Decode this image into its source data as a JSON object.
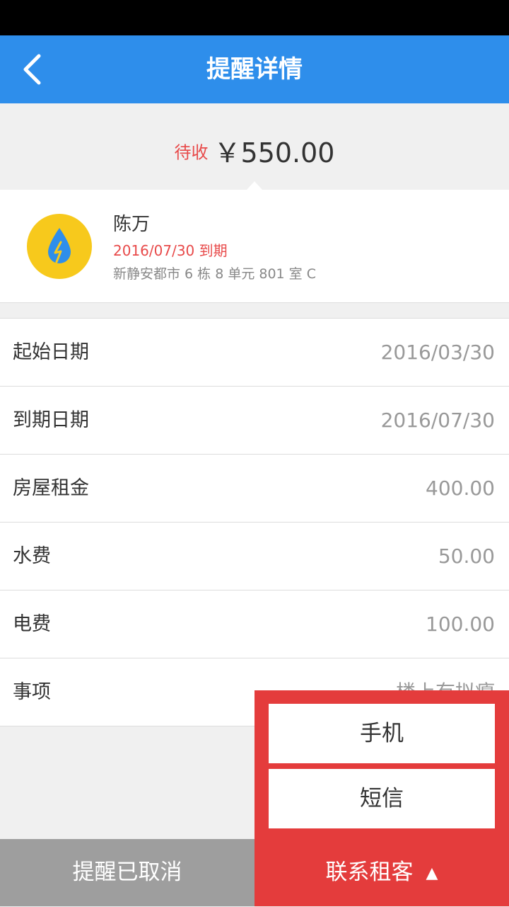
{
  "header": {
    "title": "提醒详情",
    "back_icon": "chevron-left-icon"
  },
  "summary": {
    "status_label": "待收",
    "amount": "￥550.00"
  },
  "tenant": {
    "icon": "water-drop-lightning-icon",
    "name": "陈万",
    "due": "2016/07/30 到期",
    "address": "新静安都市 6 栋 8 单元 801 室 C"
  },
  "details": [
    {
      "label": "起始日期",
      "value": "2016/03/30"
    },
    {
      "label": "到期日期",
      "value": "2016/07/30"
    },
    {
      "label": "房屋租金",
      "value": "400.00"
    },
    {
      "label": "水费",
      "value": "50.00"
    },
    {
      "label": "电费",
      "value": "100.00"
    },
    {
      "label": "事项",
      "value": "楼上有拟瘪"
    }
  ],
  "contact_menu": {
    "phone": "手机",
    "sms": "短信"
  },
  "bottom": {
    "cancel_label": "提醒已取消",
    "contact_label": "联系租客",
    "contact_arrow": "▲"
  },
  "colors": {
    "primary": "#2e8eeb",
    "accent_red": "#e43c3c",
    "due_red": "#e84a4a",
    "cancel_gray": "#9e9e9e",
    "icon_yellow": "#f7c91c",
    "drop_blue": "#2e8eeb"
  }
}
